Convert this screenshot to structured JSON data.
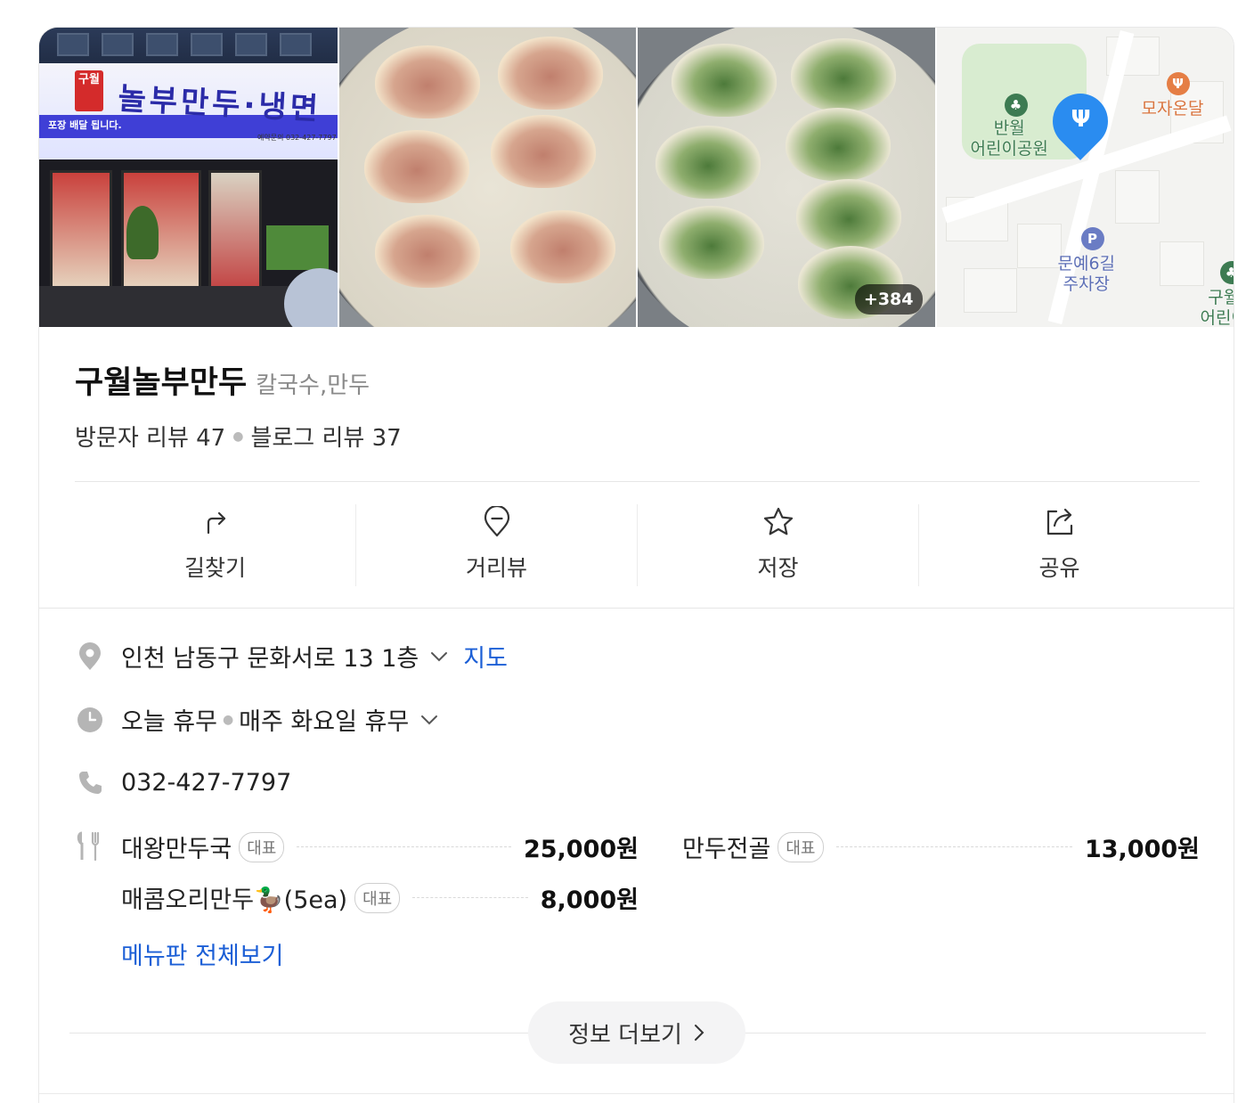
{
  "photos": {
    "more_count": "+384",
    "storefront": {
      "logo_text": "구월",
      "sign_title": "놀부만두·냉면",
      "sign_sub": "포장 배달 됩니다.",
      "sign_phone": "예약문의 032-427-7797"
    },
    "map": {
      "labels": {
        "park": "반월\n어린이공원",
        "cafe": "모자온달",
        "parking": "문예6길\n주차장",
        "park2": "구월\n어린이",
        "road": "문예6길"
      }
    }
  },
  "place": {
    "name": "구월놀부만두",
    "category": "칼국수,만두",
    "visitor_reviews": "방문자 리뷰 47",
    "blog_reviews": "블로그 리뷰 37"
  },
  "actions": [
    {
      "label": "길찾기",
      "icon": "directions-icon"
    },
    {
      "label": "거리뷰",
      "icon": "location-pin-icon"
    },
    {
      "label": "저장",
      "icon": "star-icon"
    },
    {
      "label": "공유",
      "icon": "share-icon"
    }
  ],
  "info": {
    "address": "인천 남동구 문화서로 13 1층",
    "map_link": "지도",
    "hours_status": "오늘 휴무",
    "hours_detail": "매주 화요일 휴무",
    "phone": "032-427-7797"
  },
  "menu": {
    "items": [
      {
        "name": "대왕만두국",
        "tag": "대표",
        "price": "25,000원"
      },
      {
        "name": "만두전골",
        "tag": "대표",
        "price": "13,000원"
      },
      {
        "name": "매콤오리만두🦆(5ea)",
        "tag": "대표",
        "price": "8,000원"
      }
    ],
    "see_all": "메뉴판 전체보기"
  },
  "more_info": "정보 더보기",
  "colors": {
    "link": "#1c5fd6",
    "pin": "#2a8cf0",
    "text": "#222222",
    "muted": "#8a8a8a"
  }
}
